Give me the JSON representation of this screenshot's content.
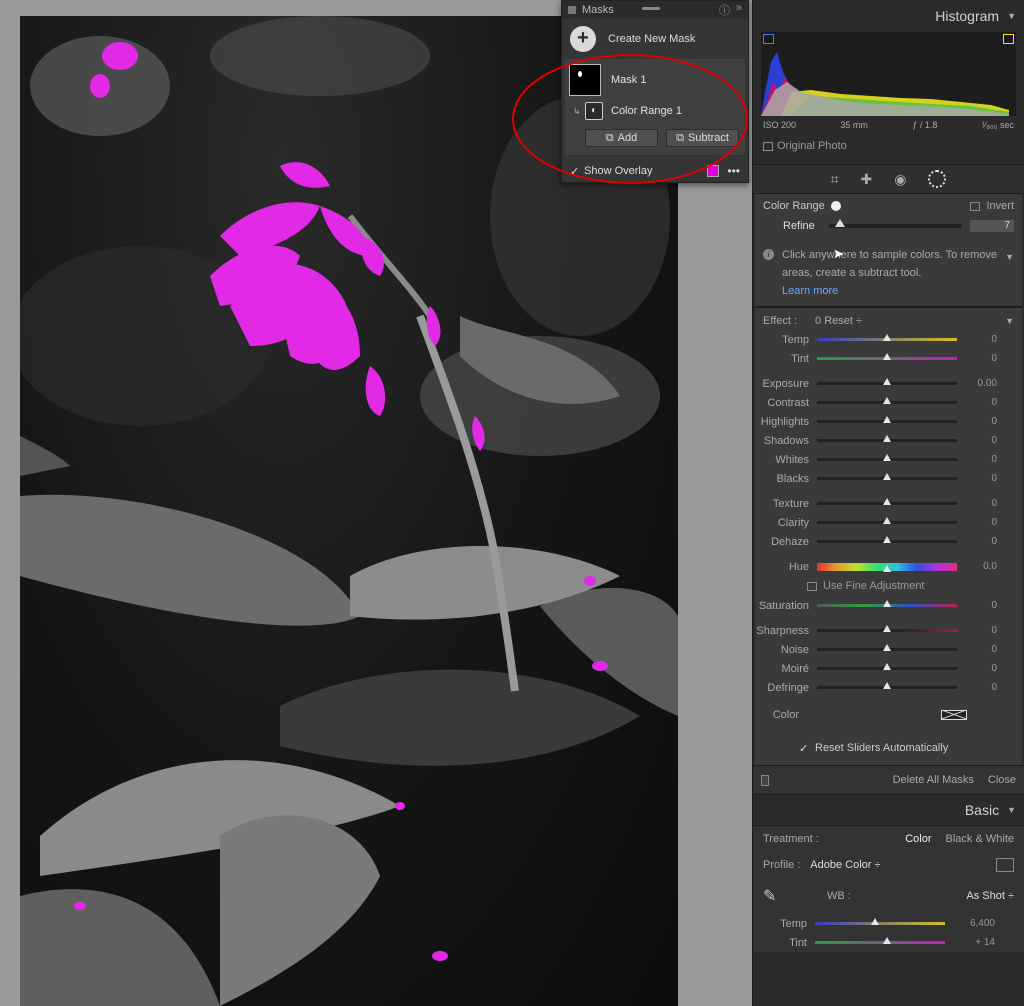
{
  "masks_panel": {
    "title": "Masks",
    "create_label": "Create New Mask",
    "mask_name": "Mask 1",
    "component_name": "Color Range 1",
    "add_label": "Add",
    "subtract_label": "Subtract",
    "overlay_label": "Show Overlay",
    "overlay_color": "#e000e0"
  },
  "histogram": {
    "title": "Histogram",
    "iso": "ISO 200",
    "focal": "35 mm",
    "aperture": "ƒ / 1.8",
    "shutter": "¹⁄₈₀₀ sec",
    "original_label": "Original Photo"
  },
  "color_range": {
    "label": "Color Range",
    "invert_label": "Invert",
    "refine_label": "Refine",
    "refine_value": "7",
    "info_text": "Click anywhere to sample colors. To remove areas, create a subtract tool.",
    "learn_more": "Learn more"
  },
  "effect": {
    "label": "Effect :",
    "preset": "0 Reset  ÷",
    "sliders": {
      "temp": {
        "label": "Temp",
        "value": "0"
      },
      "tint": {
        "label": "Tint",
        "value": "0"
      },
      "exposure": {
        "label": "Exposure",
        "value": "0.00"
      },
      "contrast": {
        "label": "Contrast",
        "value": "0"
      },
      "highlights": {
        "label": "Highlights",
        "value": "0"
      },
      "shadows": {
        "label": "Shadows",
        "value": "0"
      },
      "whites": {
        "label": "Whites",
        "value": "0"
      },
      "blacks": {
        "label": "Blacks",
        "value": "0"
      },
      "texture": {
        "label": "Texture",
        "value": "0"
      },
      "clarity": {
        "label": "Clarity",
        "value": "0"
      },
      "dehaze": {
        "label": "Dehaze",
        "value": "0"
      },
      "hue": {
        "label": "Hue",
        "value": "0.0"
      },
      "saturation": {
        "label": "Saturation",
        "value": "0"
      },
      "sharpness": {
        "label": "Sharpness",
        "value": "0"
      },
      "noise": {
        "label": "Noise",
        "value": "0"
      },
      "moire": {
        "label": "Moiré",
        "value": "0"
      },
      "defringe": {
        "label": "Defringe",
        "value": "0"
      }
    },
    "fine_adjust_label": "Use Fine Adjustment",
    "color_label": "Color",
    "reset_auto_label": "Reset Sliders Automatically"
  },
  "mask_footer": {
    "delete_all": "Delete All Masks",
    "close": "Close"
  },
  "basic": {
    "title": "Basic",
    "treatment_label": "Treatment :",
    "treatment_color": "Color",
    "treatment_bw": "Black & White",
    "profile_label": "Profile :",
    "profile_value": "Adobe Color  ÷",
    "wb_label": "WB :",
    "wb_value": "As Shot  ÷",
    "temp_label": "Temp",
    "temp_value": "6,400",
    "tint_label": "Tint",
    "tint_value": "+ 14"
  },
  "colors": {
    "accent_blue": "#6ba6ff",
    "overlay_magenta": "#e000e0",
    "annotation_red": "#e00000"
  }
}
